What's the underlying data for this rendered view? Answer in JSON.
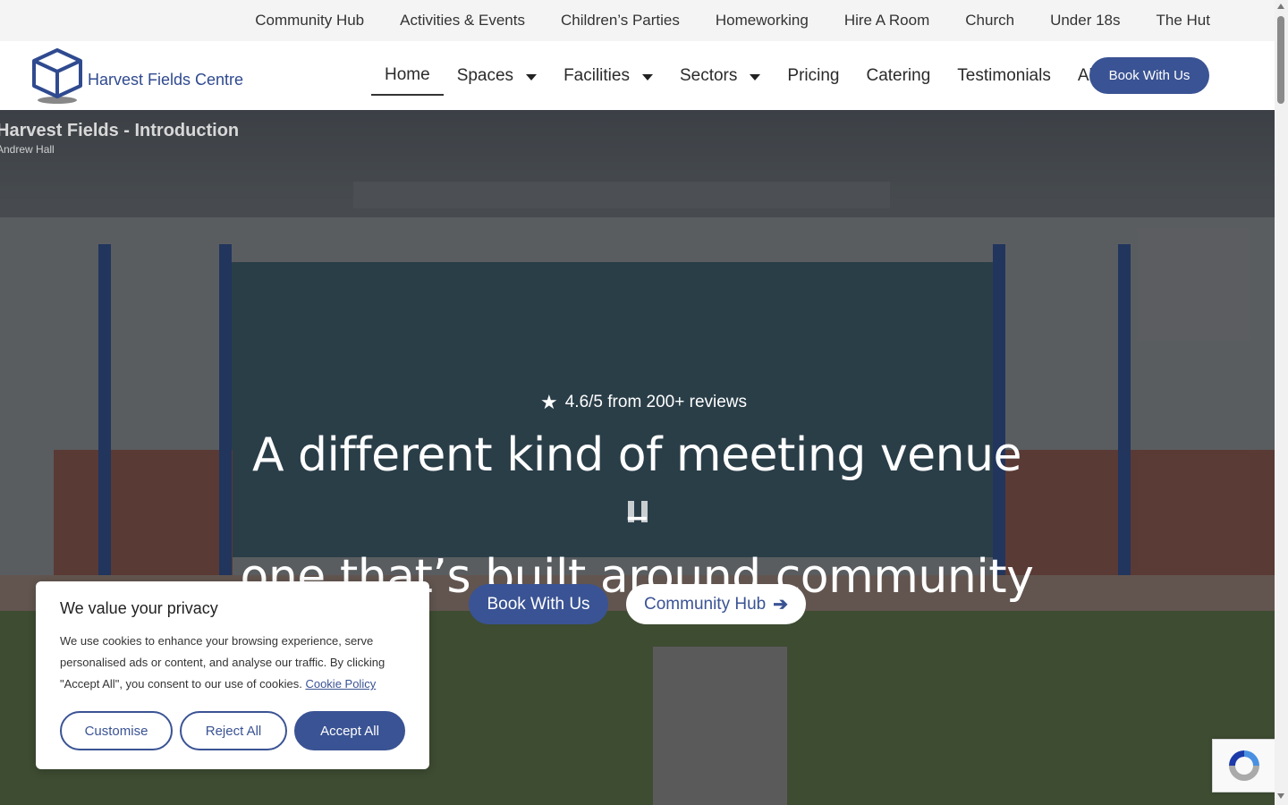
{
  "topnav": {
    "items": [
      "Community Hub",
      "Activities & Events",
      "Children’s Parties",
      "Homeworking",
      "Hire A Room",
      "Church",
      "Under 18s",
      "The Hut"
    ]
  },
  "brand": {
    "name": "Harvest Fields Centre",
    "color": "#3a5394"
  },
  "mainnav": {
    "home": "Home",
    "spaces": "Spaces",
    "facilities": "Facilities",
    "sectors": "Sectors",
    "pricing": "Pricing",
    "catering": "Catering",
    "testimonials": "Testimonials",
    "about": "About",
    "book": "Book With Us"
  },
  "hero": {
    "video_title": "Harvest Fields - Introduction",
    "video_author": "Andrew Hall",
    "rating": "4.6/5 from 200+ reviews",
    "headline_line1": "A different kind of meeting venue –",
    "headline_line2": "one that’s built around community",
    "cta_book": "Book With Us",
    "cta_hub": "Community Hub"
  },
  "cookie": {
    "title": "We value your privacy",
    "body": "We use cookies to enhance your browsing experience, serve personalised ads or content, and analyse our traffic. By clicking \"Accept All\", you consent to our use of cookies.",
    "policy_link": "Cookie Policy",
    "customise": "Customise",
    "reject": "Reject All",
    "accept": "Accept All"
  },
  "icons": {
    "star": "star-icon",
    "arrow": "arrow-right-icon",
    "caret": "chevron-down-icon",
    "pause": "pause-icon",
    "logo": "cube-logo-icon",
    "recaptcha": "recaptcha-icon"
  }
}
